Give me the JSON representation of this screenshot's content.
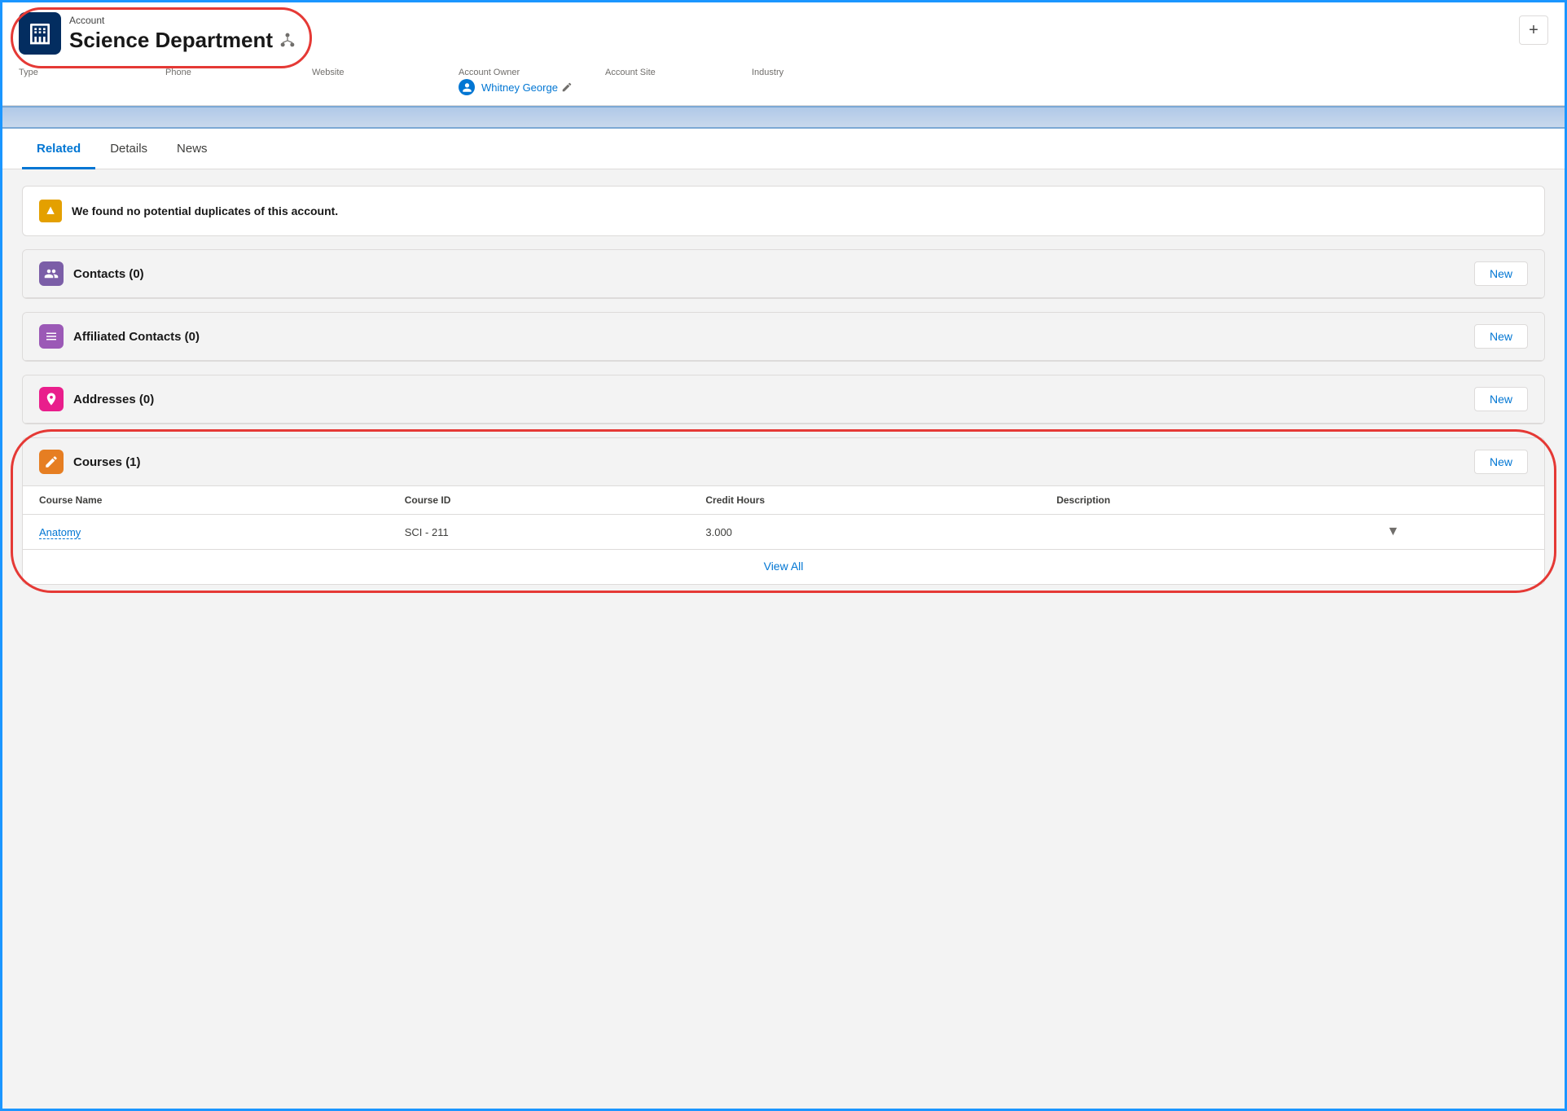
{
  "header": {
    "account_label": "Account",
    "account_name": "Science Department",
    "type_label": "Type",
    "phone_label": "Phone",
    "website_label": "Website",
    "account_owner_label": "Account Owner",
    "account_owner_value": "Whitney George",
    "account_site_label": "Account Site",
    "industry_label": "Industry",
    "plus_label": "+"
  },
  "tabs": {
    "related_label": "Related",
    "details_label": "Details",
    "news_label": "News"
  },
  "duplicate_banner": {
    "text": "We found no potential duplicates of this account."
  },
  "related_lists": {
    "contacts": {
      "title": "Contacts (0)",
      "new_label": "New"
    },
    "affiliated_contacts": {
      "title": "Affiliated Contacts (0)",
      "new_label": "New"
    },
    "addresses": {
      "title": "Addresses (0)",
      "new_label": "New"
    },
    "courses": {
      "title": "Courses (1)",
      "new_label": "New",
      "columns": [
        "Course Name",
        "Course ID",
        "Credit Hours",
        "Description"
      ],
      "rows": [
        {
          "course_name": "Anatomy",
          "course_id": "SCI - 211",
          "credit_hours": "3.000",
          "description": ""
        }
      ],
      "view_all_label": "View All"
    }
  }
}
